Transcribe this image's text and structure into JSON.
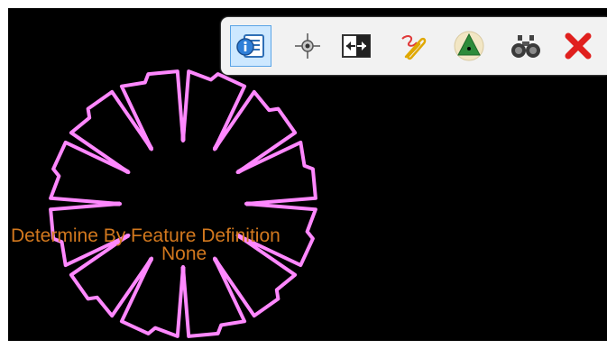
{
  "viewport": {
    "background": "#000000",
    "feature_color": "#ff88ff",
    "label_color": "#d2781e",
    "labels": {
      "primary": "Determine By Feature Definition",
      "secondary": "None"
    }
  },
  "toolbar": {
    "background": "#f2f2f2",
    "buttons": [
      {
        "icon": "info-icon",
        "state": "active"
      },
      {
        "icon": "snap-point-icon",
        "state": "normal"
      },
      {
        "icon": "toggle-direction-icon",
        "state": "normal"
      },
      {
        "icon": "clip-icon",
        "state": "normal"
      },
      {
        "icon": "triangle-badge-icon",
        "state": "normal"
      },
      {
        "icon": "binoculars-icon",
        "state": "normal"
      },
      {
        "icon": "close-icon",
        "state": "normal"
      }
    ]
  }
}
